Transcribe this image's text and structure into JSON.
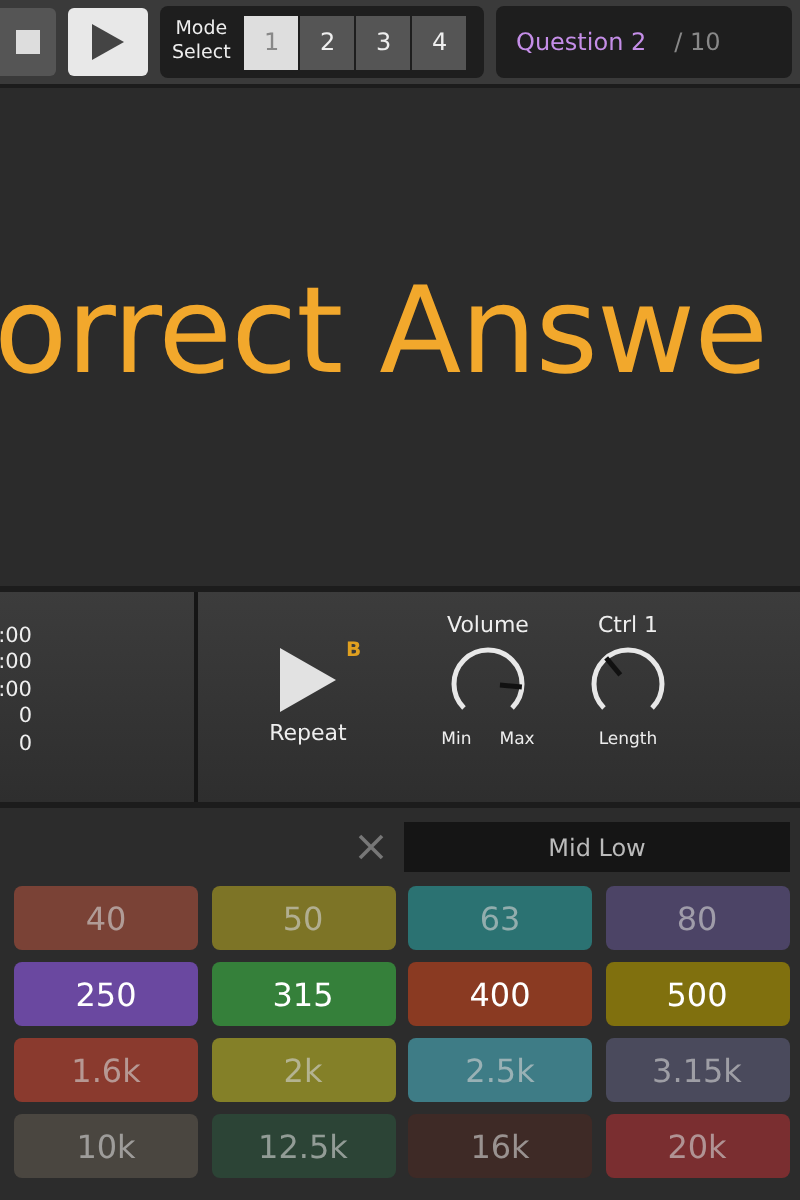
{
  "transport": {
    "stop": {
      "on": false
    },
    "play": {
      "on": true
    }
  },
  "mode_select": {
    "label_1": "Mode",
    "label_2": "Select",
    "modes": [
      {
        "label": "1",
        "selected": true
      },
      {
        "label": "2",
        "selected": false
      },
      {
        "label": "3",
        "selected": false
      },
      {
        "label": "4",
        "selected": false
      }
    ]
  },
  "question": {
    "label": "Question 2",
    "total": "/ 10"
  },
  "feedback": "orrect Answe",
  "stats": [
    ":00",
    ":00",
    ":00",
    "0",
    "0"
  ],
  "repeat": {
    "label": "Repeat",
    "badge": "B"
  },
  "knobs": [
    {
      "title": "Volume",
      "min": "Min",
      "max": "Max"
    },
    {
      "title": "Ctrl 1",
      "caption": "Length"
    }
  ],
  "band": {
    "value": "Mid Low"
  },
  "grid": [
    {
      "highlighted": false,
      "cells": [
        {
          "label": "40",
          "color": "#7a4236"
        },
        {
          "label": "50",
          "color": "#7d7426"
        },
        {
          "label": "63",
          "color": "#2b7272"
        },
        {
          "label": "80",
          "color": "#4c4466"
        }
      ]
    },
    {
      "highlighted": true,
      "cells": [
        {
          "label": "250",
          "color": "#6a48a0"
        },
        {
          "label": "315",
          "color": "#35803a"
        },
        {
          "label": "400",
          "color": "#8a3a22"
        },
        {
          "label": "500",
          "color": "#80700e"
        }
      ]
    },
    {
      "highlighted": false,
      "cells": [
        {
          "label": "1.6k",
          "color": "#8a3a2e"
        },
        {
          "label": "2k",
          "color": "#848028"
        },
        {
          "label": "2.5k",
          "color": "#3e7c86"
        },
        {
          "label": "3.15k",
          "color": "#4a4a5c"
        }
      ]
    },
    {
      "highlighted": false,
      "cells": [
        {
          "label": "10k",
          "color": "#4a4640"
        },
        {
          "label": "12.5k",
          "color": "#2c4436"
        },
        {
          "label": "16k",
          "color": "#3e2a26"
        },
        {
          "label": "20k",
          "color": "#7a2e30"
        }
      ]
    }
  ]
}
